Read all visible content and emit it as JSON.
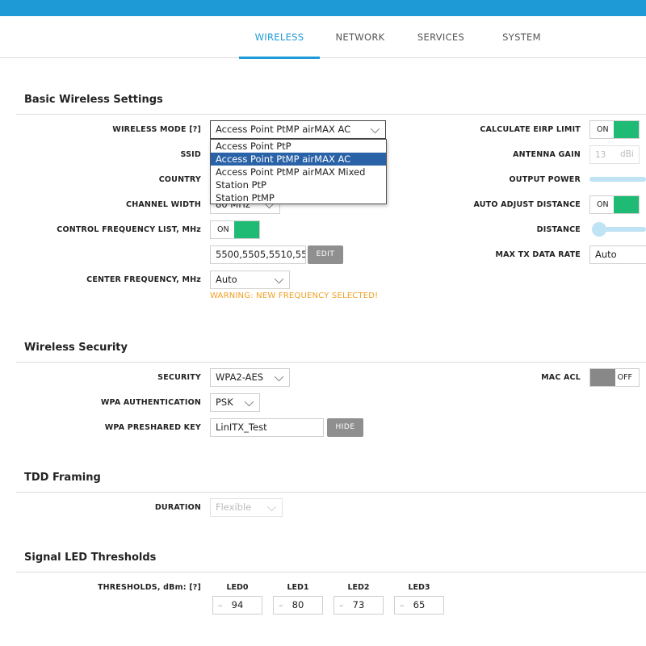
{
  "tabs": [
    {
      "label": "WIRELESS",
      "active": true
    },
    {
      "label": "NETWORK",
      "active": false
    },
    {
      "label": "SERVICES",
      "active": false
    },
    {
      "label": "SYSTEM",
      "active": false
    }
  ],
  "colors": {
    "accent": "#1e9ad6",
    "toggle_on": "#1fbb74",
    "toggle_off": "#888888",
    "warning": "#f0a020",
    "dropdown_selected": "#2a62a8"
  },
  "basic": {
    "title": "Basic Wireless Settings",
    "wireless_mode": {
      "label": "WIRELESS MODE [?]",
      "value": "Access Point PtMP airMAX AC",
      "options": [
        "Access Point PtP",
        "Access Point PtMP airMAX AC",
        "Access Point PtMP airMAX Mixed",
        "Station PtP",
        "Station PtMP"
      ],
      "selected_index": 1
    },
    "ssid_label": "SSID",
    "country_label": "COUNTRY",
    "channel_width": {
      "label": "CHANNEL WIDTH",
      "value": "80 MHz"
    },
    "control_freq": {
      "label": "CONTROL FREQUENCY LIST, MHz",
      "toggle": "ON",
      "value": "5500,5505,5510,55",
      "edit_label": "EDIT"
    },
    "center_freq": {
      "label": "CENTER FREQUENCY, MHz",
      "value": "Auto"
    },
    "warning": "WARNING: NEW FREQUENCY SELECTED!",
    "eirp": {
      "label": "CALCULATE EIRP LIMIT",
      "toggle": "ON"
    },
    "antenna_gain": {
      "label": "ANTENNA GAIN",
      "value": "13",
      "unit": "dBi"
    },
    "output_power_label": "OUTPUT POWER",
    "auto_distance": {
      "label": "AUTO ADJUST DISTANCE",
      "toggle": "ON"
    },
    "distance_label": "DISTANCE",
    "max_tx_rate": {
      "label": "MAX TX DATA RATE",
      "value": "Auto"
    }
  },
  "security": {
    "title": "Wireless Security",
    "security": {
      "label": "SECURITY",
      "value": "WPA2-AES"
    },
    "wpa_auth": {
      "label": "WPA AUTHENTICATION",
      "value": "PSK"
    },
    "psk": {
      "label": "WPA PRESHARED KEY",
      "value": "LinITX_Test",
      "hide_label": "HIDE"
    },
    "mac_acl": {
      "label": "MAC ACL",
      "toggle": "OFF"
    }
  },
  "tdd": {
    "title": "TDD Framing",
    "duration": {
      "label": "DURATION",
      "value": "Flexible"
    }
  },
  "led": {
    "title": "Signal LED Thresholds",
    "label": "THRESHOLDS, dBm: [?]",
    "items": [
      {
        "name": "LED0",
        "minus": "–",
        "value": "94"
      },
      {
        "name": "LED1",
        "minus": "–",
        "value": "80"
      },
      {
        "name": "LED2",
        "minus": "–",
        "value": "73"
      },
      {
        "name": "LED3",
        "minus": "–",
        "value": "65"
      }
    ]
  }
}
